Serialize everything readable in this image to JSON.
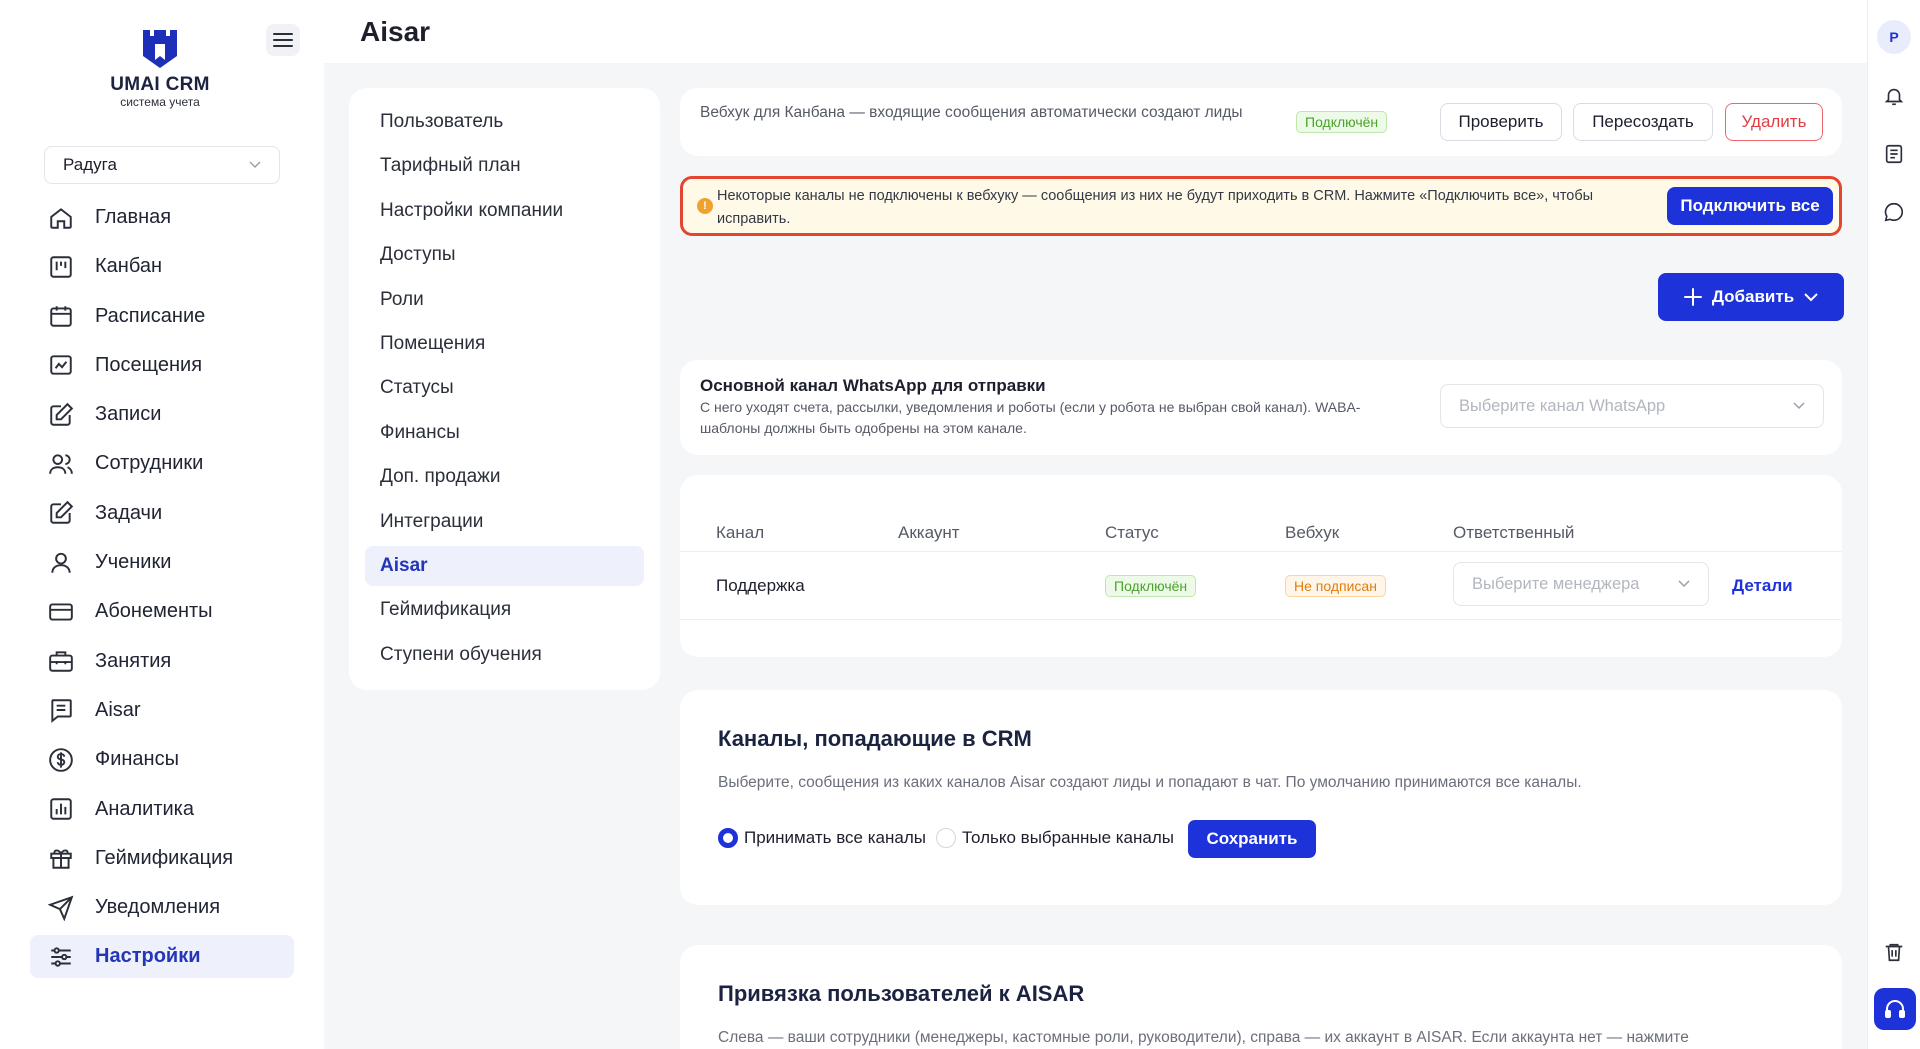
{
  "brand": {
    "name": "UMAI CRM",
    "subtitle": "система учета"
  },
  "branch": {
    "selected": "Радуга"
  },
  "sidebar": {
    "items": [
      {
        "label": "Главная",
        "icon": "home-icon"
      },
      {
        "label": "Канбан",
        "icon": "kanban-icon"
      },
      {
        "label": "Расписание",
        "icon": "calendar-icon"
      },
      {
        "label": "Посещения",
        "icon": "chart-icon"
      },
      {
        "label": "Записи",
        "icon": "edit-icon"
      },
      {
        "label": "Сотрудники",
        "icon": "users-icon"
      },
      {
        "label": "Задачи",
        "icon": "tasks-icon"
      },
      {
        "label": "Ученики",
        "icon": "user-icon"
      },
      {
        "label": "Абонементы",
        "icon": "card-icon"
      },
      {
        "label": "Занятия",
        "icon": "briefcase-icon"
      },
      {
        "label": "Aisar",
        "icon": "message-icon"
      },
      {
        "label": "Финансы",
        "icon": "dollar-icon"
      },
      {
        "label": "Аналитика",
        "icon": "bar-chart-icon"
      },
      {
        "label": "Геймификация",
        "icon": "gift-icon"
      },
      {
        "label": "Уведомления",
        "icon": "send-icon"
      },
      {
        "label": "Настройки",
        "icon": "sliders-icon"
      }
    ],
    "active": "Настройки"
  },
  "page": {
    "title": "Aisar"
  },
  "submenu": {
    "items": [
      "Пользователь",
      "Тарифный план",
      "Настройки компании",
      "Доступы",
      "Роли",
      "Помещения",
      "Статусы",
      "Финансы",
      "Доп. продажи",
      "Интеграции",
      "Aisar",
      "Геймификация",
      "Ступени обучения"
    ],
    "active": "Aisar"
  },
  "webhook": {
    "text": "Вебхук для Канбана — входящие сообщения автоматически создают лиды",
    "status": "Подключён",
    "check_label": "Проверить",
    "recreate_label": "Пересоздать",
    "delete_label": "Удалить"
  },
  "alert": {
    "message": "Некоторые каналы не подключены к вебхуку — сообщения из них не будут приходить в CRM. Нажмите «Подключить все», чтобы исправить.",
    "action_label": "Подключить все"
  },
  "add_button": {
    "label": "Добавить"
  },
  "whatsapp": {
    "title": "Основной канал WhatsApp для отправки",
    "description": "С него уходят счета, рассылки, уведомления и роботы (если у робота не выбран свой канал). WABA-шаблоны должны быть одобрены на этом канале.",
    "placeholder": "Выберите канал WhatsApp"
  },
  "channels_table": {
    "headers": [
      "Канал",
      "Аккаунт",
      "Статус",
      "Вебхук",
      "Ответственный"
    ],
    "rows": [
      {
        "channel": "Поддержка",
        "account": "",
        "status": "Подключён",
        "webhook": "Не подписан",
        "manager_placeholder": "Выберите менеджера",
        "details": "Детали"
      }
    ]
  },
  "crm_channels": {
    "title": "Каналы, попадающие в CRM",
    "description": "Выберите, сообщения из каких каналов Aisar создают лиды и попадают в чат. По умолчанию принимаются все каналы.",
    "option_all": "Принимать все каналы",
    "option_selected": "Только выбранные каналы",
    "selected_option": "all",
    "save_label": "Сохранить"
  },
  "binding": {
    "title": "Привязка пользователей к AISAR",
    "description": "Слева — ваши сотрудники (менеджеры, кастомные роли, руководители), справа — их аккаунт в AISAR. Если аккаунта нет — нажмите"
  },
  "rail": {
    "avatar": "Р"
  },
  "colors": {
    "accent": "#1d32d8",
    "danger": "#e03e44",
    "success": "#49a32b",
    "warning": "#e27d0c"
  }
}
